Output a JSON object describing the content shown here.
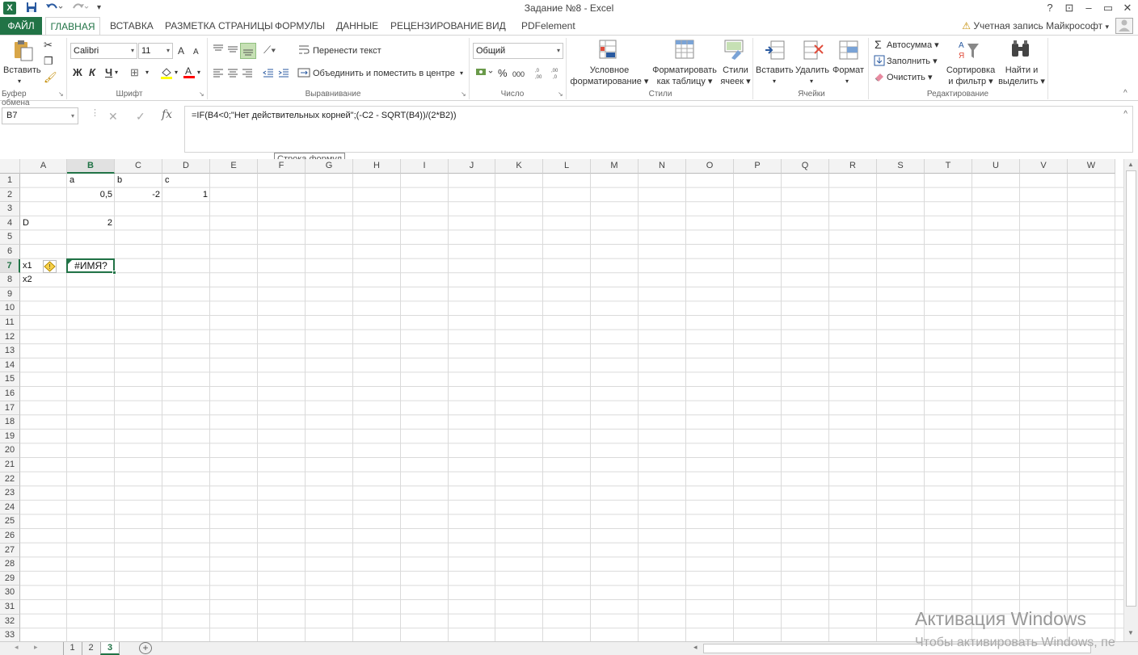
{
  "titlebar": {
    "app_letter": "X",
    "title": "Задание №8 - Excel",
    "help": "?",
    "ribbon_display": "⊡",
    "minimize": "–",
    "restore": "▭",
    "close": "✕",
    "save_icon": "save-icon",
    "undo_icon": "undo-icon",
    "redo_icon": "redo-icon"
  },
  "tabs": {
    "file": "ФАЙЛ",
    "home": "ГЛАВНАЯ",
    "insert": "ВСТАВКА",
    "layout": "РАЗМЕТКА СТРАНИЦЫ",
    "formulas": "ФОРМУЛЫ",
    "data": "ДАННЫЕ",
    "review": "РЕЦЕНЗИРОВАНИЕ",
    "view": "ВИД",
    "pdf": "PDFelement"
  },
  "account": {
    "label": "Учетная запись Майкрософт",
    "warn": "⚠"
  },
  "ribbon": {
    "clipboard": {
      "paste": "Вставить",
      "label": "Буфер обмена"
    },
    "font": {
      "name": "Calibri",
      "size": "11",
      "grow": "A",
      "shrink": "A",
      "bold": "Ж",
      "italic": "К",
      "underline": "Ч",
      "label": "Шрифт"
    },
    "alignment": {
      "wrap": "Перенести текст",
      "merge": "Объединить и поместить в центре",
      "label": "Выравнивание"
    },
    "number": {
      "format": "Общий",
      "percent": "%",
      "thousands": "000",
      "inc_decimal": "←,0",
      ".dec_decimal": ",00",
      "label": "Число"
    },
    "styles": {
      "conditional_1": "Условное",
      "conditional_2": "форматирование",
      "table_1": "Форматировать",
      "table_2": "как таблицу",
      "cell_1": "Стили",
      "cell_2": "ячеек",
      "label": "Стили"
    },
    "cells": {
      "insert": "Вставить",
      "delete": "Удалить",
      "format": "Формат",
      "label": "Ячейки"
    },
    "editing": {
      "autosum": "Автосумма",
      "fill": "Заполнить",
      "clear": "Очистить",
      "sort_1": "Сортировка",
      "sort_2": "и фильтр",
      "find_1": "Найти и",
      "find_2": "выделить",
      "label": "Редактирование"
    }
  },
  "formula_bar": {
    "name_box": "B7",
    "fx": "fx",
    "formula": "=IF(B4<0;\"Нет действительных корней\";(-C2 - SQRT(B4))/(2*B2))",
    "tooltip": "Строка формул"
  },
  "grid": {
    "columns": [
      "A",
      "B",
      "C",
      "D",
      "E",
      "F",
      "G",
      "H",
      "I",
      "J",
      "K",
      "L",
      "M",
      "N",
      "O",
      "P",
      "Q",
      "R",
      "S",
      "T",
      "U",
      "V",
      "W"
    ],
    "rows": [
      "1",
      "2",
      "3",
      "4",
      "5",
      "6",
      "7",
      "8",
      "9",
      "10",
      "11",
      "12",
      "13",
      "14",
      "15",
      "16",
      "17",
      "18",
      "19",
      "20",
      "21",
      "22",
      "23",
      "24",
      "25",
      "26",
      "27",
      "28",
      "29",
      "30",
      "31",
      "32",
      "33"
    ],
    "cells": {
      "B1": "a",
      "C1": "b",
      "D1": "c",
      "B2": "0,5",
      "C2": "-2",
      "D2": "1",
      "A4": "D",
      "B4": "2",
      "A7": "x1",
      "B7": "#ИМЯ?",
      "A8": "x2"
    }
  },
  "sheets": {
    "tabs": [
      "1",
      "2",
      "3"
    ],
    "active": "3",
    "add": "+"
  },
  "watermark": {
    "line1": "Активация Windows",
    "line2": "Чтобы активировать Windows, пе"
  }
}
